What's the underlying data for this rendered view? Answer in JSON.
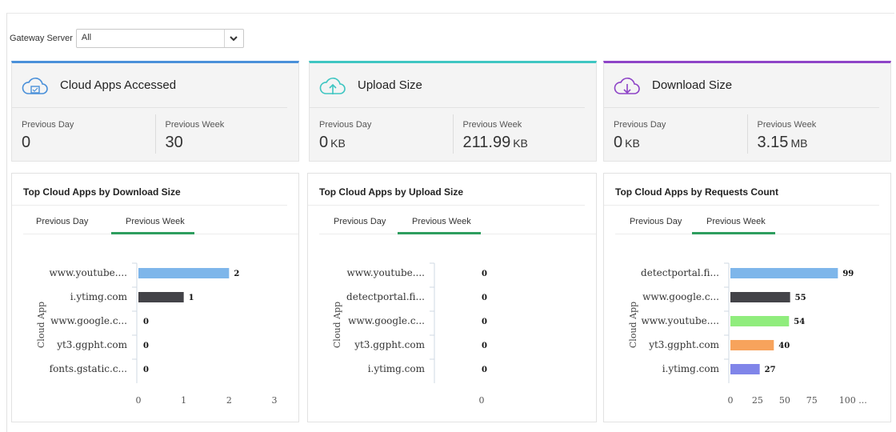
{
  "filter": {
    "label": "Gateway Server",
    "value": "All"
  },
  "colors": {
    "apps": "#4a90d9",
    "upload": "#3fc6c2",
    "download": "#8e44c7",
    "tab_active": "#2e9e5f"
  },
  "stats": [
    {
      "title": "Cloud Apps Accessed",
      "icon": "cloud-app-icon",
      "prev_day_label": "Previous Day",
      "prev_day_value": "0",
      "prev_day_unit": "",
      "prev_week_label": "Previous Week",
      "prev_week_value": "30",
      "prev_week_unit": ""
    },
    {
      "title": "Upload Size",
      "icon": "cloud-upload-icon",
      "prev_day_label": "Previous Day",
      "prev_day_value": "0",
      "prev_day_unit": "KB",
      "prev_week_label": "Previous Week",
      "prev_week_value": "211.99",
      "prev_week_unit": "KB"
    },
    {
      "title": "Download Size",
      "icon": "cloud-download-icon",
      "prev_day_label": "Previous Day",
      "prev_day_value": "0",
      "prev_day_unit": "KB",
      "prev_week_label": "Previous Week",
      "prev_week_value": "3.15",
      "prev_week_unit": "MB"
    }
  ],
  "panels": [
    {
      "title": "Top Cloud Apps by Download Size",
      "tab_day": "Previous Day",
      "tab_week": "Previous Week",
      "active_tab": "Previous Week"
    },
    {
      "title": "Top Cloud Apps by Upload Size",
      "tab_day": "Previous Day",
      "tab_week": "Previous Week",
      "active_tab": "Previous Week"
    },
    {
      "title": "Top Cloud Apps by Requests Count",
      "tab_day": "Previous Day",
      "tab_week": "Previous Week",
      "active_tab": "Previous Week"
    }
  ],
  "chart_data": [
    {
      "type": "bar",
      "orientation": "horizontal",
      "ylabel": "Cloud App",
      "categories": [
        "www.youtube....",
        "i.ytimg.com",
        "www.google.c...",
        "yt3.ggpht.com",
        "fonts.gstatic.c..."
      ],
      "values": [
        2,
        1,
        0,
        0,
        0
      ],
      "colors": [
        "#7eb6ea",
        "#434348",
        "#90ed7d",
        "#f7a35c",
        "#8085e9"
      ],
      "xlim": [
        0,
        3
      ],
      "xticks": [
        "0",
        "1",
        "2",
        "3"
      ]
    },
    {
      "type": "bar",
      "orientation": "horizontal",
      "ylabel": "Cloud App",
      "categories": [
        "www.youtube....",
        "detectportal.fi...",
        "www.google.c...",
        "yt3.ggpht.com",
        "i.ytimg.com"
      ],
      "values": [
        0,
        0,
        0,
        0,
        0
      ],
      "colors": [
        "#7eb6ea",
        "#434348",
        "#90ed7d",
        "#f7a35c",
        "#8085e9"
      ],
      "xlim": [
        0,
        1
      ],
      "xticks": [
        "0"
      ]
    },
    {
      "type": "bar",
      "orientation": "horizontal",
      "ylabel": "Cloud App",
      "categories": [
        "detectportal.fi...",
        "www.google.c...",
        "www.youtube....",
        "yt3.ggpht.com",
        "i.ytimg.com"
      ],
      "values": [
        99,
        55,
        54,
        40,
        27
      ],
      "colors": [
        "#7eb6ea",
        "#434348",
        "#90ed7d",
        "#f7a35c",
        "#8085e9"
      ],
      "xlim": [
        0,
        112
      ],
      "xticks": [
        "0",
        "25",
        "50",
        "75",
        "100 ..."
      ]
    }
  ]
}
